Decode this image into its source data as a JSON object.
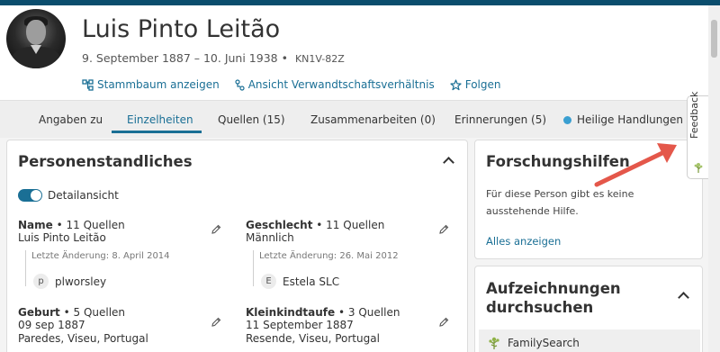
{
  "person": {
    "name": "Luis Pinto Leitão",
    "dates": "9. September 1887 – 10. Juni 1938 •",
    "id": "KN1V-82Z"
  },
  "actions": {
    "tree": "Stammbaum anzeigen",
    "relationship": "Ansicht Verwandtschaftsverhältnis",
    "follow": "Folgen"
  },
  "tabs": [
    {
      "label": "Angaben zu"
    },
    {
      "label": "Einzelheiten"
    },
    {
      "label": "Quellen (15)"
    },
    {
      "label": "Zusammenarbeiten (0)"
    },
    {
      "label": "Erinnerungen (5)"
    },
    {
      "label": "Heilige Handlungen"
    }
  ],
  "vital": {
    "title": "Personenstandliches",
    "toggle_label": "Detailansicht",
    "name": {
      "label": "Name",
      "sources": "• 11 Quellen",
      "value": "Luis Pinto Leitão",
      "last_change": "Letzte Änderung: 8. April 2014",
      "contributor_initial": "p",
      "contributor": "plworsley"
    },
    "gender": {
      "label": "Geschlecht",
      "sources": "• 11 Quellen",
      "value": "Männlich",
      "last_change": "Letzte Änderung: 26. Mai 2012",
      "contributor_initial": "E",
      "contributor": "Estela SLC"
    },
    "birth": {
      "label": "Geburt",
      "sources": "• 5 Quellen",
      "value": "09 sep 1887",
      "place": "Paredes, Viseu, Portugal"
    },
    "christening": {
      "label": "Kleinkindtaufe",
      "sources": "• 3 Quellen",
      "value": "11 September 1887",
      "place": "Resende, Viseu, Portugal"
    }
  },
  "research": {
    "title": "Forschungshilfen",
    "text": "Für diese Person gibt es keine ausstehende Hilfe.",
    "show_all": "Alles anzeigen"
  },
  "records": {
    "title_line1": "Aufzeichnungen",
    "title_line2": "durchsuchen",
    "source": "FamilySearch"
  },
  "feedback": {
    "label": "Feedback"
  },
  "colors": {
    "accent": "#1a6f95",
    "topbar": "#0b4d6d",
    "annotation_arrow": "#e4574a"
  }
}
